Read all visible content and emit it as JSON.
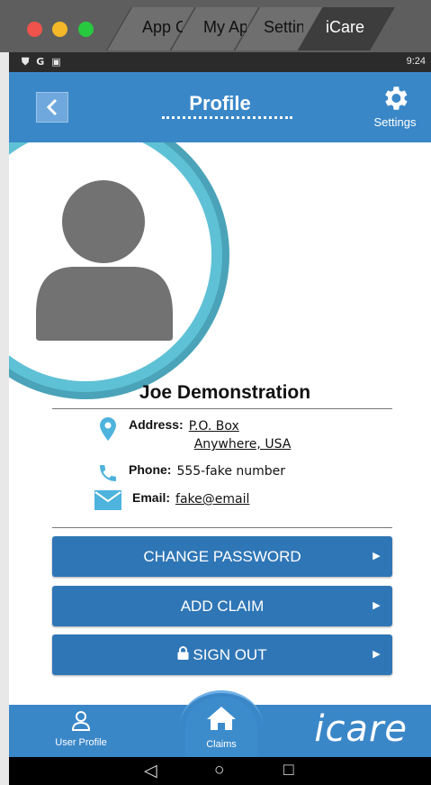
{
  "window": {
    "tabs": [
      {
        "label": "App Center"
      },
      {
        "label": "My Apps"
      },
      {
        "label": "Settings"
      },
      {
        "label": "iCare"
      }
    ]
  },
  "status_bar": {
    "icons": [
      "shield-icon",
      "g-icon",
      "a-icon"
    ],
    "time": "9:24"
  },
  "header": {
    "back_label": "<",
    "title": "Profile",
    "settings_label": "Settings"
  },
  "profile": {
    "name": "Joe Demonstration",
    "address": {
      "label": "Address:",
      "line1": "P.O. Box",
      "line2": "Anywhere, USA"
    },
    "phone": {
      "label": "Phone:",
      "value": "555-fake  number"
    },
    "email": {
      "label": "Email:",
      "value": "fake@email"
    }
  },
  "actions": {
    "change_password": "CHANGE PASSWORD",
    "add_claim": "ADD CLAIM",
    "sign_out": "SIGN OUT",
    "chevron": "▸"
  },
  "bottom_nav": {
    "user_profile": "User Profile",
    "claims": "Claims",
    "brand": "icare"
  },
  "android_nav": {
    "back": "◁",
    "home": "○",
    "recents": "□"
  },
  "colors": {
    "header_blue": "#3a87c8",
    "button_blue": "#2f76b6",
    "icon_teal": "#4eb3dd",
    "ring_teal": "#5fc1d6"
  }
}
